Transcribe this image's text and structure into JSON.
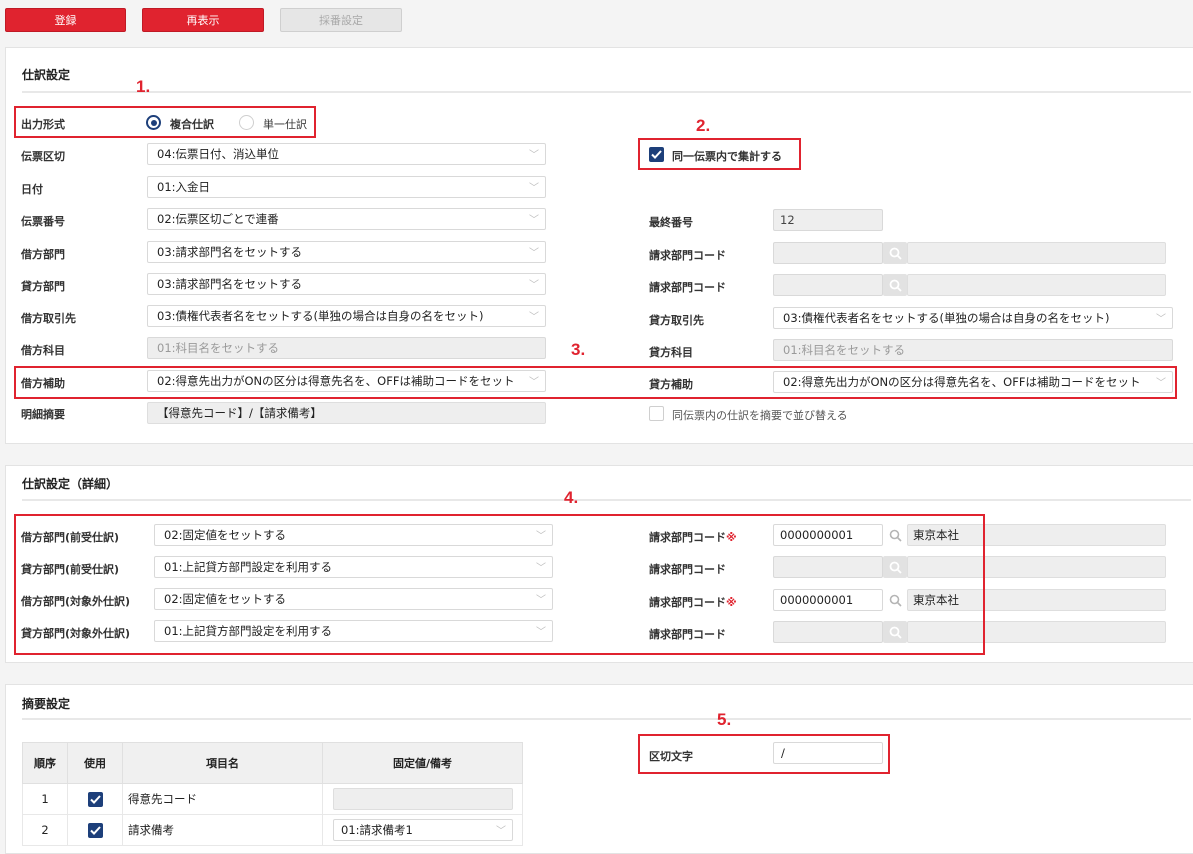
{
  "toolbar": {
    "register": "登録",
    "redisplay": "再表示",
    "numbering": "採番設定"
  },
  "annotations": [
    "1.",
    "2.",
    "3.",
    "4.",
    "5."
  ],
  "journal": {
    "title": "仕訳設定",
    "output_format": {
      "label": "出力形式",
      "option1": "複合仕訳",
      "option2": "単一仕訳",
      "selected": "複合仕訳"
    },
    "aggregate": {
      "label": "同一伝票内で集計する",
      "checked": true
    },
    "slip_division": {
      "label": "伝票区切",
      "value": "04:伝票日付、消込単位"
    },
    "date": {
      "label": "日付",
      "value": "01:入金日"
    },
    "slip_number": {
      "label": "伝票番号",
      "value": "02:伝票区切ごとで連番"
    },
    "last_number": {
      "label": "最終番号",
      "value": "12"
    },
    "debit_dept": {
      "label": "借方部門",
      "value": "03:請求部門名をセットする"
    },
    "debit_dept_code": {
      "label": "請求部門コード"
    },
    "credit_dept": {
      "label": "貸方部門",
      "value": "03:請求部門名をセットする"
    },
    "credit_dept_code": {
      "label": "請求部門コード"
    },
    "debit_partner": {
      "label": "借方取引先",
      "value": "03:債権代表者名をセットする(単独の場合は自身の名をセット)"
    },
    "credit_partner": {
      "label": "貸方取引先",
      "value": "03:債権代表者名をセットする(単独の場合は自身の名をセット)"
    },
    "debit_account": {
      "label": "借方科目",
      "value": "01:科目名をセットする"
    },
    "credit_account": {
      "label": "貸方科目",
      "value": "01:科目名をセットする"
    },
    "debit_sub": {
      "label": "借方補助",
      "value": "02:得意先出力がONの区分は得意先名を、OFFは補助コードをセット"
    },
    "credit_sub": {
      "label": "貸方補助",
      "value": "02:得意先出力がONの区分は得意先名を、OFFは補助コードをセット"
    },
    "detail_summary": {
      "label": "明細摘要",
      "value": "【得意先コード】/【請求備考】"
    },
    "sort_option": {
      "label": "同伝票内の仕訳を摘要で並び替える",
      "checked": false
    }
  },
  "detail": {
    "title": "仕訳設定（詳細）",
    "rows": [
      {
        "label": "借方部門(前受仕訳)",
        "value": "02:固定値をセットする",
        "code_label": "請求部門コード",
        "required": "※",
        "code": "0000000001",
        "name": "東京本社"
      },
      {
        "label": "貸方部門(前受仕訳)",
        "value": "01:上記貸方部門設定を利用する",
        "code_label": "請求部門コード",
        "required": "",
        "code": "",
        "name": ""
      },
      {
        "label": "借方部門(対象外仕訳)",
        "value": "02:固定値をセットする",
        "code_label": "請求部門コード",
        "required": "※",
        "code": "0000000001",
        "name": "東京本社"
      },
      {
        "label": "貸方部門(対象外仕訳)",
        "value": "01:上記貸方部門設定を利用する",
        "code_label": "請求部門コード",
        "required": "",
        "code": "",
        "name": ""
      }
    ]
  },
  "summary": {
    "title": "摘要設定",
    "separator": {
      "label": "区切文字",
      "value": "/"
    },
    "table": {
      "headers": [
        "順序",
        "使用",
        "項目名",
        "固定値/備考"
      ],
      "rows": [
        {
          "order": "1",
          "use": true,
          "item": "得意先コード",
          "fixed": ""
        },
        {
          "order": "2",
          "use": true,
          "item": "請求備考",
          "fixed": "01:請求備考1"
        }
      ]
    }
  },
  "colors": {
    "accent_red": "#e0232f",
    "check_navy": "#1d3f7a"
  }
}
